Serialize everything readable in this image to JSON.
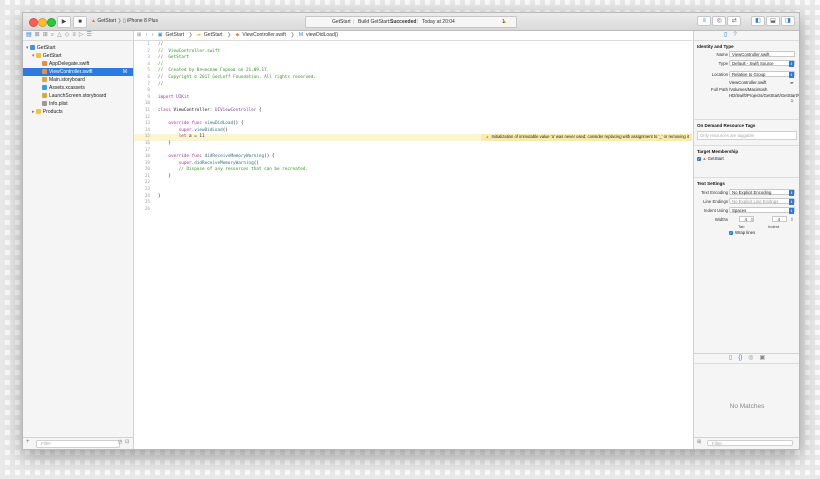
{
  "toolbar": {
    "run_icon": "play-icon",
    "stop_icon": "stop-icon",
    "scheme": "GetStart",
    "device": "iPhone 8 Plus",
    "activity_project": "GetStart",
    "activity_status_prefix": "Build GetStart:",
    "activity_status": "Succeeded",
    "activity_time": "Today at 20:04",
    "warning_count": "1"
  },
  "navigator": {
    "items": [
      {
        "label": "GetStart",
        "badge": ""
      },
      {
        "label": "GetStart",
        "badge": ""
      },
      {
        "label": "AppDelegate.swift",
        "badge": ""
      },
      {
        "label": "ViewController.swift",
        "badge": "M"
      },
      {
        "label": "Main.storyboard",
        "badge": ""
      },
      {
        "label": "Assets.xcassets",
        "badge": ""
      },
      {
        "label": "LaunchScreen.storyboard",
        "badge": ""
      },
      {
        "label": "Info.plist",
        "badge": ""
      },
      {
        "label": "Products",
        "badge": ""
      }
    ],
    "filter_placeholder": "Filter"
  },
  "jumpbar": {
    "project": "GetStart",
    "group": "GetStart",
    "file": "ViewController.swift",
    "symbol": "viewDidLoad()"
  },
  "code": {
    "lines": [
      {
        "n": "1",
        "text": "//"
      },
      {
        "n": "2",
        "text": "//  ViewController.swift"
      },
      {
        "n": "3",
        "text": "//  GetStart"
      },
      {
        "n": "4",
        "text": "//"
      },
      {
        "n": "5",
        "text": "//  Created by Вячеслав Горлов on 21.09.17."
      },
      {
        "n": "6",
        "text": "//  Copyright © 2017 GoсLoff Foundation. All rights reserved."
      },
      {
        "n": "7",
        "text": "//"
      },
      {
        "n": "8",
        "text": ""
      },
      {
        "n": "9",
        "text": "import UIKit"
      },
      {
        "n": "10",
        "text": ""
      },
      {
        "n": "11",
        "text": "class ViewController: UIViewController {"
      },
      {
        "n": "12",
        "text": ""
      },
      {
        "n": "13",
        "text": "    override func viewDidLoad() {"
      },
      {
        "n": "14",
        "text": "        super.viewDidLoad()"
      },
      {
        "n": "15",
        "text": "        let a = 11"
      },
      {
        "n": "16",
        "text": "    }"
      },
      {
        "n": "17",
        "text": ""
      },
      {
        "n": "18",
        "text": "    override func didReceiveMemoryWarning() {"
      },
      {
        "n": "19",
        "text": "        super.didReceiveMemoryWarning()"
      },
      {
        "n": "20",
        "text": "        // Dispose of any resources that can be recreated."
      },
      {
        "n": "21",
        "text": "    }"
      },
      {
        "n": "22",
        "text": ""
      },
      {
        "n": "23",
        "text": ""
      },
      {
        "n": "24",
        "text": "}"
      },
      {
        "n": "25",
        "text": ""
      },
      {
        "n": "26",
        "text": ""
      }
    ],
    "warning": "Initialization of immutable value 'a' was never used; consider replacing with assignment to '_' or removing it"
  },
  "inspector": {
    "identity_title": "Identity and Type",
    "name_label": "Name",
    "name_value": "ViewController.swift",
    "type_label": "Type",
    "type_value": "Default - Swift Source",
    "location_label": "Location",
    "location_value": "Relative to Group",
    "location_file": "ViewController.swift",
    "fullpath_label": "Full Path",
    "fullpath_value": "/Volumes/Macintosh HD/Swift/Projects/GetStart/GetStart/ViewController.swift",
    "ondemand_title": "On Demand Resource Tags",
    "tags_placeholder": "Only resources are taggable",
    "target_title": "Target Membership",
    "target_name": "GetStart",
    "text_title": "Text Settings",
    "encoding_label": "Text Encoding",
    "encoding_value": "No Explicit Encoding",
    "line_endings_label": "Line Endings",
    "line_endings_value": "No Explicit Line Endings",
    "indent_label": "Indent Using",
    "indent_value": "Spaces",
    "widths_label": "Widths",
    "tab_value": "4",
    "indent_width_value": "4",
    "tab_label": "Tab",
    "indent_sub_label": "Indent",
    "wrap_label": "Wrap lines",
    "no_matches": "No Matches",
    "filter_placeholder": "Filter"
  },
  "colors": {
    "accent": "#2a7ae2",
    "warning_bg": "#fbeab0",
    "comment": "#3a8e2e",
    "keyword": "#b3259b"
  }
}
